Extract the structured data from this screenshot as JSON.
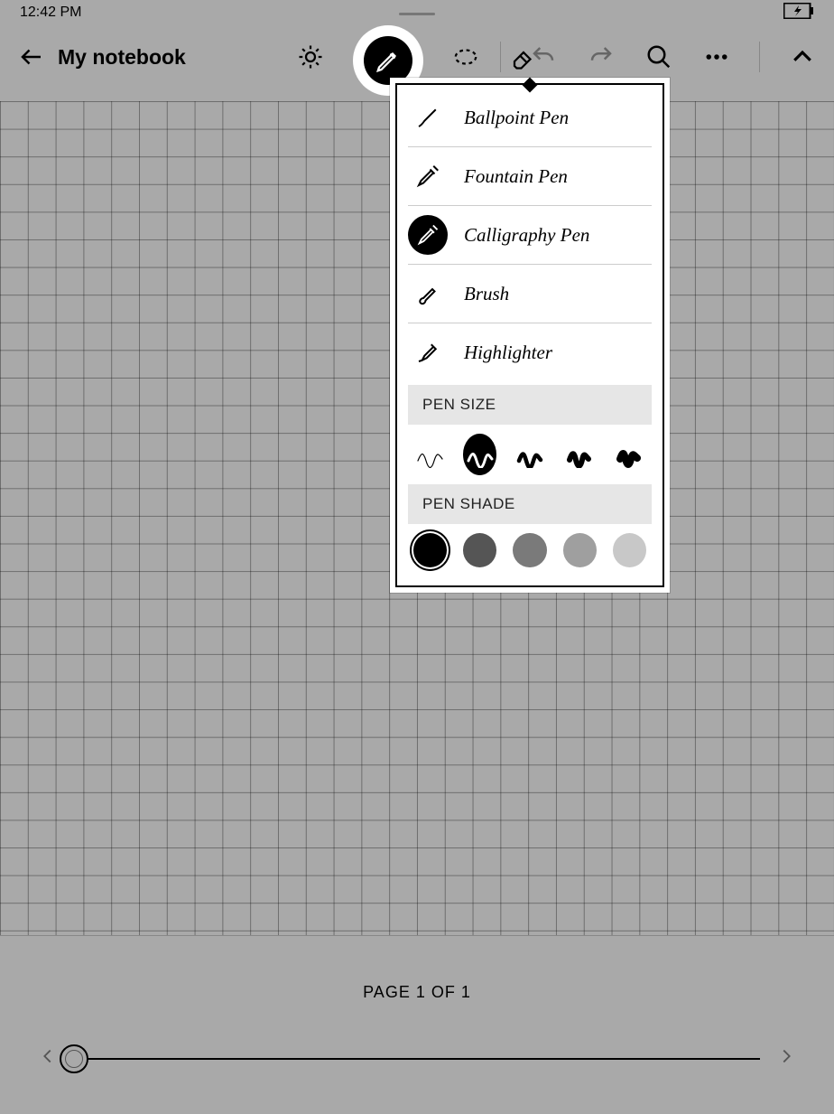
{
  "status": {
    "time": "12:42 PM"
  },
  "header": {
    "title": "My notebook"
  },
  "pen_menu": {
    "items": [
      {
        "label": "Ballpoint Pen"
      },
      {
        "label": "Fountain Pen"
      },
      {
        "label": "Calligraphy Pen"
      },
      {
        "label": "Brush"
      },
      {
        "label": "Highlighter"
      }
    ],
    "selected_index": 2,
    "size_header": "PEN SIZE",
    "shade_header": "PEN SHADE",
    "size_count": 5,
    "selected_size_index": 1,
    "shades": [
      "#000000",
      "#555555",
      "#7a7a7a",
      "#9f9f9f",
      "#c8c8c8"
    ],
    "selected_shade_index": 0
  },
  "footer": {
    "page_label": "PAGE 1 OF 1"
  }
}
